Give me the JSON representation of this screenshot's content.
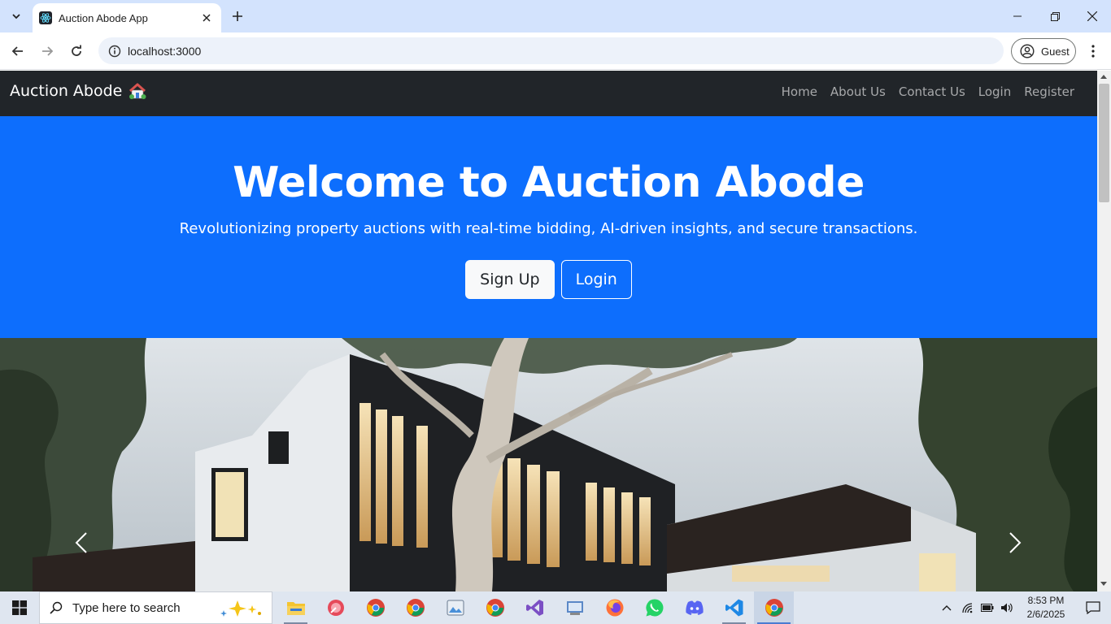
{
  "browser": {
    "tab_title": "Auction Abode App",
    "url": "localhost:3000",
    "profile_label": "Guest"
  },
  "site": {
    "brand": "Auction Abode",
    "brand_emoji": "🏡",
    "nav_links": [
      "Home",
      "About Us",
      "Contact Us",
      "Login",
      "Register"
    ]
  },
  "hero": {
    "title": "Welcome to Auction Abode",
    "subtitle": "Revolutionizing property auctions with real-time bidding, AI-driven insights, and secure transactions.",
    "primary_button": "Sign Up",
    "secondary_button": "Login"
  },
  "taskbar": {
    "search_placeholder": "Type here to search",
    "time": "8:53 PM",
    "date": "2/6/2025"
  },
  "colors": {
    "hero_bg": "#0d6efd",
    "navbar_bg": "#212529",
    "tab_strip": "#d3e3fd"
  }
}
